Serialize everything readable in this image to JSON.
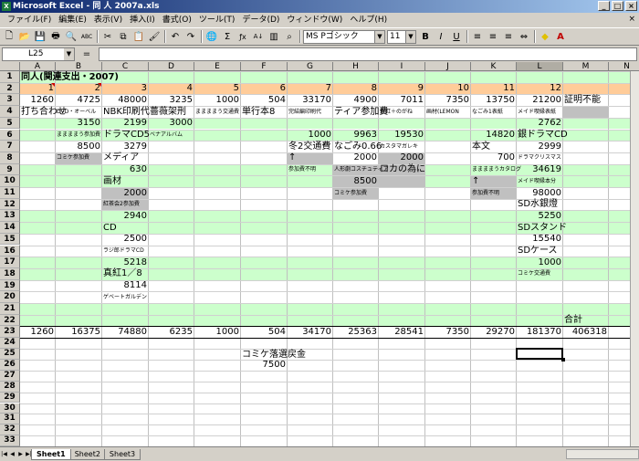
{
  "title": "Microsoft Excel - 同 人 2007a.xls",
  "title_controls": [
    "_",
    "□",
    "×"
  ],
  "menu": [
    "ファイル(F)",
    "編集(E)",
    "表示(V)",
    "挿入(I)",
    "書式(O)",
    "ツール(T)",
    "データ(D)",
    "ウィンドウ(W)",
    "ヘルプ(H)"
  ],
  "menu_close": "×",
  "toolbar": {
    "icons": [
      "new-icon",
      "open-icon",
      "save-icon",
      "print-icon",
      "preview-icon",
      "spellcheck-icon",
      "cut-icon",
      "copy-icon",
      "paste-icon",
      "format-painter-icon",
      "undo-icon",
      "redo-icon",
      "hyperlink-icon",
      "autosum-icon",
      "function-icon",
      "sort-asc-icon",
      "chart-icon",
      "zoom-icon"
    ],
    "glyphs": [
      "🗋",
      "📂",
      "💾",
      "🖶",
      "🔍",
      "ABC",
      "✂",
      "⧉",
      "📋",
      "🖌",
      "↶",
      "↷",
      "🌐",
      "Σ",
      "ƒx",
      "A↓",
      "▥",
      "⌕"
    ],
    "font_name": "MS Pゴシック",
    "font_size": "11",
    "bold": "B",
    "italic": "I",
    "underline": "U",
    "align_glyphs": [
      "≡",
      "≡",
      "≡",
      "⇔"
    ],
    "fill_glyph": "◆",
    "fontcolor_glyph": "A"
  },
  "name_box": "L25",
  "formula_eq": "=",
  "columns": [
    "A",
    "B",
    "C",
    "D",
    "E",
    "F",
    "G",
    "H",
    "I",
    "J",
    "K",
    "L",
    "M",
    "N"
  ],
  "selected_column": "L",
  "rows": [
    "1",
    "2",
    "3",
    "4",
    "5",
    "6",
    "7",
    "8",
    "9",
    "10",
    "11",
    "12",
    "13",
    "14",
    "15",
    "16",
    "17",
    "18",
    "19",
    "20",
    "21",
    "22",
    "23",
    "24",
    "25",
    "26",
    "27",
    "28",
    "29",
    "30",
    "31",
    "32",
    "33",
    "34",
    "35"
  ],
  "cells": {
    "title": "同人(関連支出・2007)",
    "r2": [
      "1",
      "2",
      "3",
      "4",
      "5",
      "6",
      "7",
      "8",
      "9",
      "10",
      "11",
      "12"
    ],
    "r3": [
      "1260",
      "4725",
      "48000",
      "3235",
      "1000",
      "504",
      "33170",
      "4900",
      "7011",
      "7350",
      "13750",
      "21200"
    ],
    "r3_M": "証明不能",
    "r4": [
      "打ち合わせ",
      "DVD・オーベル",
      "NBK印刷代",
      "薔薇架刑",
      "ままままう交通費",
      "単行本8",
      "完結編印刷代",
      "ティア参加費",
      "真紅＋のがね",
      "画材(LEMON",
      "なごみ1表紙",
      "メイド喫縁表紙"
    ],
    "B5": "3150",
    "B6": "ままままう参加費",
    "B7": "8500",
    "B8": "コミケ参加費",
    "C5": "2199",
    "C6": "ドラマCD5",
    "C7": "3279",
    "C8": "メディア",
    "C9": "630",
    "C10": "画材",
    "C11": "2000",
    "C12": "紅茶会2参加費",
    "C13": "2940",
    "C14": "CD",
    "C15": "2500",
    "C16": "ラジ郎ドラマCD",
    "C17": "5218",
    "C18": "真紅1／8",
    "C19": "8114",
    "C20": "ゲベートガルデン",
    "D5": "3000",
    "D6": "ベナアルバム",
    "G6": "1000",
    "G7": "冬2交通費",
    "G8": "↑",
    "G9": "参加費不明",
    "H6": "9963",
    "H7": "なごみ0.66",
    "H8": "2000",
    "H9": "人形劇コスチュティア",
    "H10": "8500",
    "H11": "コミケ参加費",
    "I6": "19530",
    "I7": "カスタマガレキ",
    "I8": "2000",
    "I9": "ロカの為に",
    "K6": "14820",
    "K7": "本文",
    "K8": "700",
    "K9": "ままままうカタログ",
    "K10": "↑",
    "K11": "参加費不明",
    "L5": "2762",
    "L6": "銀ドラマCD",
    "L7": "2999",
    "L8": "ドラマクリスマス",
    "L9": "34619",
    "L10": "メイド喫縁本分",
    "L11": "98000",
    "L12": "SD水銀燈",
    "L13": "5250",
    "L14": "SDスタンド",
    "L15": "15540",
    "L16": "SDケース",
    "L17": "1000",
    "L18": "コミケ交通費",
    "M22": "合計",
    "r23": [
      "1260",
      "16375",
      "74880",
      "6235",
      "1000",
      "504",
      "34170",
      "25363",
      "28541",
      "7350",
      "29270",
      "181370"
    ],
    "M23": "406318",
    "F25": "コミケ落選戻金",
    "F26": "7500"
  },
  "sheets": [
    "Sheet1",
    "Sheet2",
    "Sheet3"
  ],
  "nav": [
    "|◀",
    "◀",
    "▶",
    "▶|"
  ],
  "colors": {
    "green_band": "#ccffcc",
    "orange_band": "#ffcc99",
    "gray_cell": "#c0c0c0",
    "title_bar": "#0a246a"
  }
}
